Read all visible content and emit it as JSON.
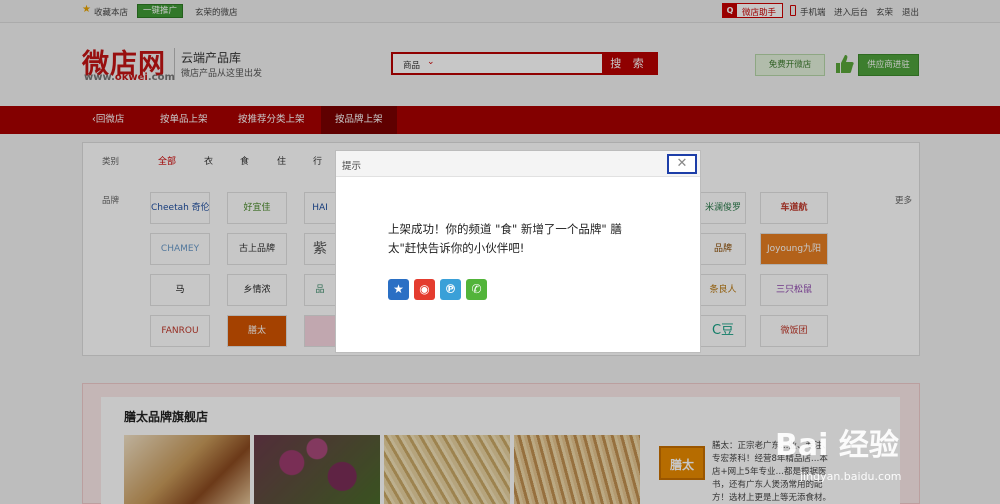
{
  "topbar": {
    "favorite": "收藏本店",
    "promo": "一键推广",
    "user_shop": "玄荣的微店",
    "assistant": "微店助手",
    "mobile": "手机端",
    "backend": "进入后台",
    "username": "玄荣",
    "logout": "退出"
  },
  "header": {
    "logo": "微店网",
    "logo_url_prefix": "www.",
    "logo_url_brand": "okwei",
    "logo_url_suffix": ".com",
    "slogan_title": "云端产品库",
    "slogan_sub": "微店产品从这里出发",
    "search_category": "商品",
    "search_value": "",
    "search_button": "搜 索",
    "open_shop": "免费开微店",
    "supplier": "供应商进驻"
  },
  "nav": {
    "back": "回微店",
    "by_product": "按单品上架",
    "by_category": "按推荐分类上架",
    "by_brand": "按品牌上架"
  },
  "filter": {
    "category_label": "类别",
    "categories": [
      "全部",
      "衣",
      "食",
      "住",
      "行"
    ],
    "brand_label": "品牌",
    "more": "更多",
    "brands_left": [
      [
        "Cheetah 奇伦",
        "好宜佳",
        "HAI"
      ],
      [
        "CHAMEY",
        "古上品牌",
        "紫"
      ],
      [
        "马",
        "乡情浓",
        "品"
      ],
      [
        "FANROU",
        "膳太",
        ""
      ]
    ],
    "brands_right": [
      [
        "米澜俊罗",
        "车道航"
      ],
      [
        "品牌",
        "Joyoung九阳"
      ],
      [
        "条良人",
        "三只松鼠"
      ],
      [
        "C豆",
        "微饭团"
      ]
    ]
  },
  "store": {
    "title": "膳太品牌旗舰店",
    "brand_logo": "膳太",
    "description": "膳太：正宗老广东…业、专注、专宏茶科！经营8年精品店…本店+网上5年专业…都是根据医书，还有广东人煲汤常用的配方！选材上更是上等无添食材。"
  },
  "modal": {
    "title": "提示",
    "close": "✕",
    "message_line1": "上架成功！你的频道 \"食\" 新增了一个品牌\" 膳",
    "message_line2": "太\"赶快告诉你的小伙伴吧!",
    "share_icons": [
      "qzone-icon",
      "weibo-icon",
      "tencent-weibo-icon",
      "wechat-icon"
    ]
  },
  "watermark": {
    "line1": "Bai 经验",
    "line2": "jingyan.baidu.com"
  },
  "colors": {
    "brand_red": "#a80000",
    "green": "#4fa23b",
    "modal_close_border": "#1d3ea8"
  }
}
